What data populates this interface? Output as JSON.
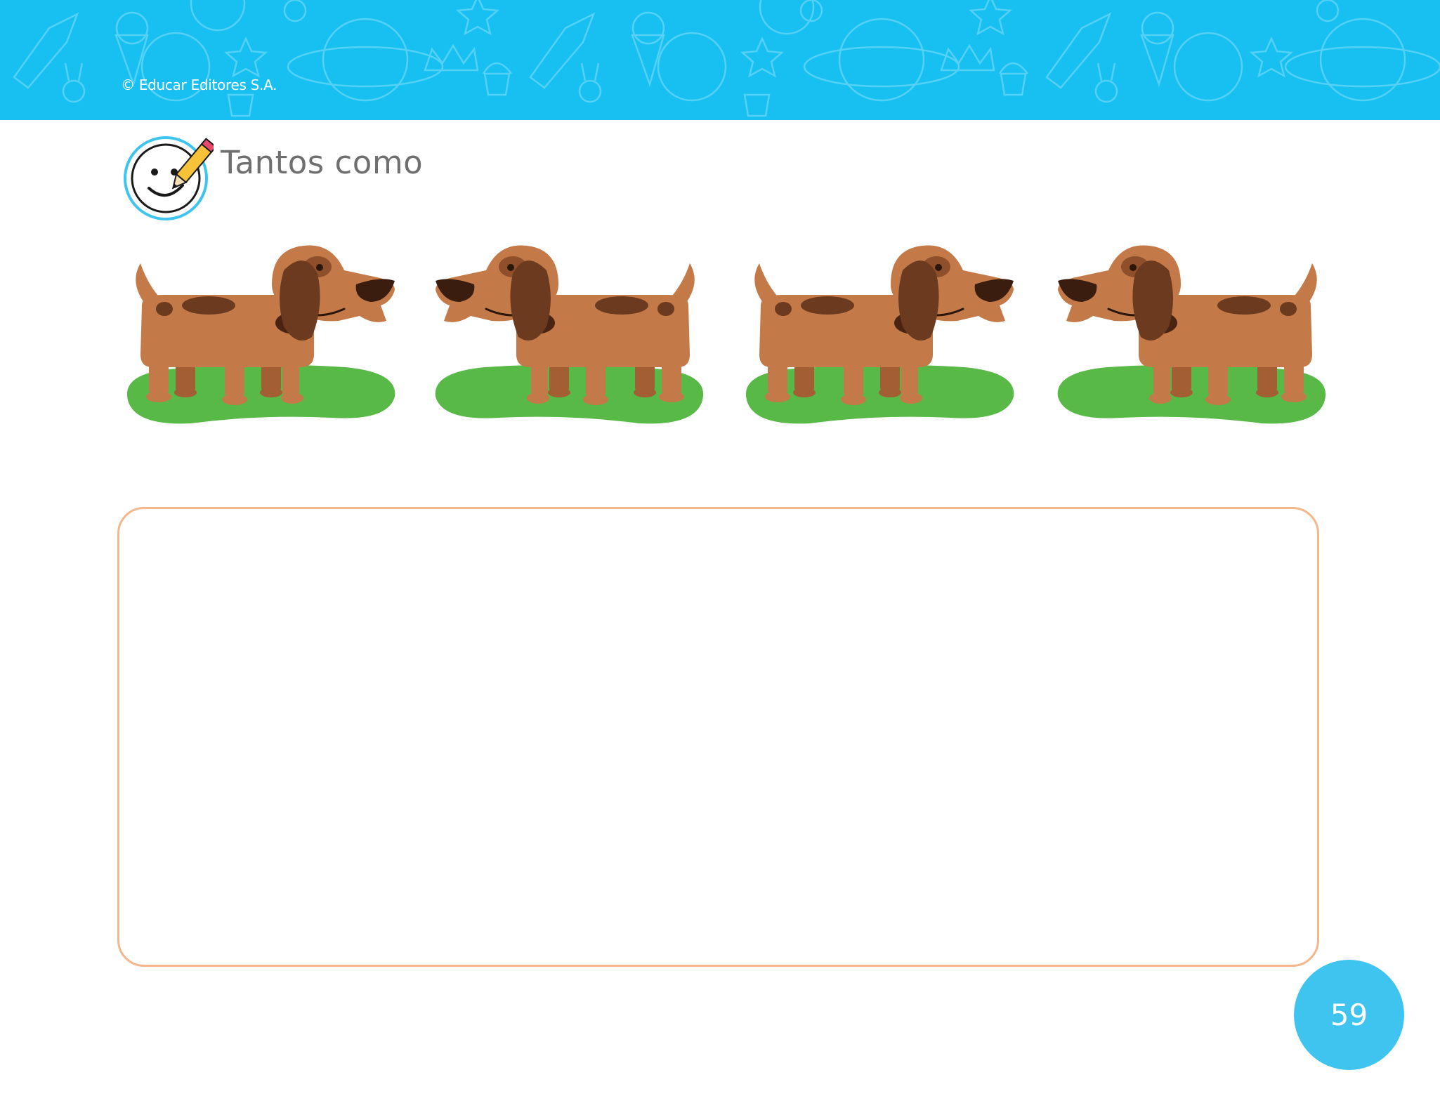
{
  "header": {
    "copyright": "© Educar Editores S.A.",
    "background_color": "#17c0f1",
    "pattern_icons": [
      "rocket-icon",
      "ice-cream-icon",
      "planet-icon",
      "star-icon",
      "crown-icon",
      "cupcake-icon",
      "bunny-icon",
      "globe-icon"
    ]
  },
  "section": {
    "title": "Tantos como",
    "icon": "smiley-pencil-icon"
  },
  "dogs": [
    {
      "facing": "right",
      "icon": "dog-icon"
    },
    {
      "facing": "left",
      "icon": "dog-icon"
    },
    {
      "facing": "right",
      "icon": "dog-icon"
    },
    {
      "facing": "left",
      "icon": "dog-icon"
    }
  ],
  "answer_box": {
    "border_color": "#f4b68a"
  },
  "footer": {
    "page_number": "59",
    "badge_color": "#3fc4f0"
  }
}
